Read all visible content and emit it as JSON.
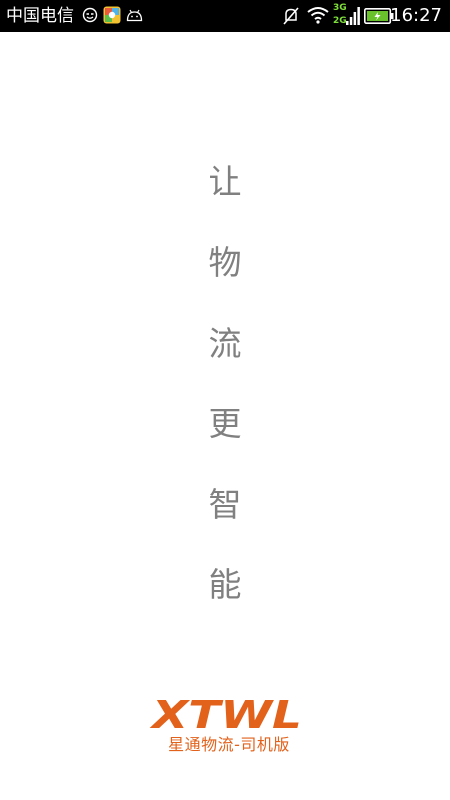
{
  "status_bar": {
    "carrier": "中国电信",
    "network_top": "3G",
    "network_bottom": "2G",
    "time": "16:27",
    "icons": [
      "face-icon",
      "app-icon",
      "android-icon",
      "mute-icon",
      "wifi-icon",
      "signal-icon",
      "battery-icon"
    ]
  },
  "slogan": [
    "让",
    "物",
    "流",
    "更",
    "智",
    "能"
  ],
  "logo": {
    "mark": "XTWL",
    "subtitle": "星通物流-司机版",
    "color": "#e2621b"
  }
}
